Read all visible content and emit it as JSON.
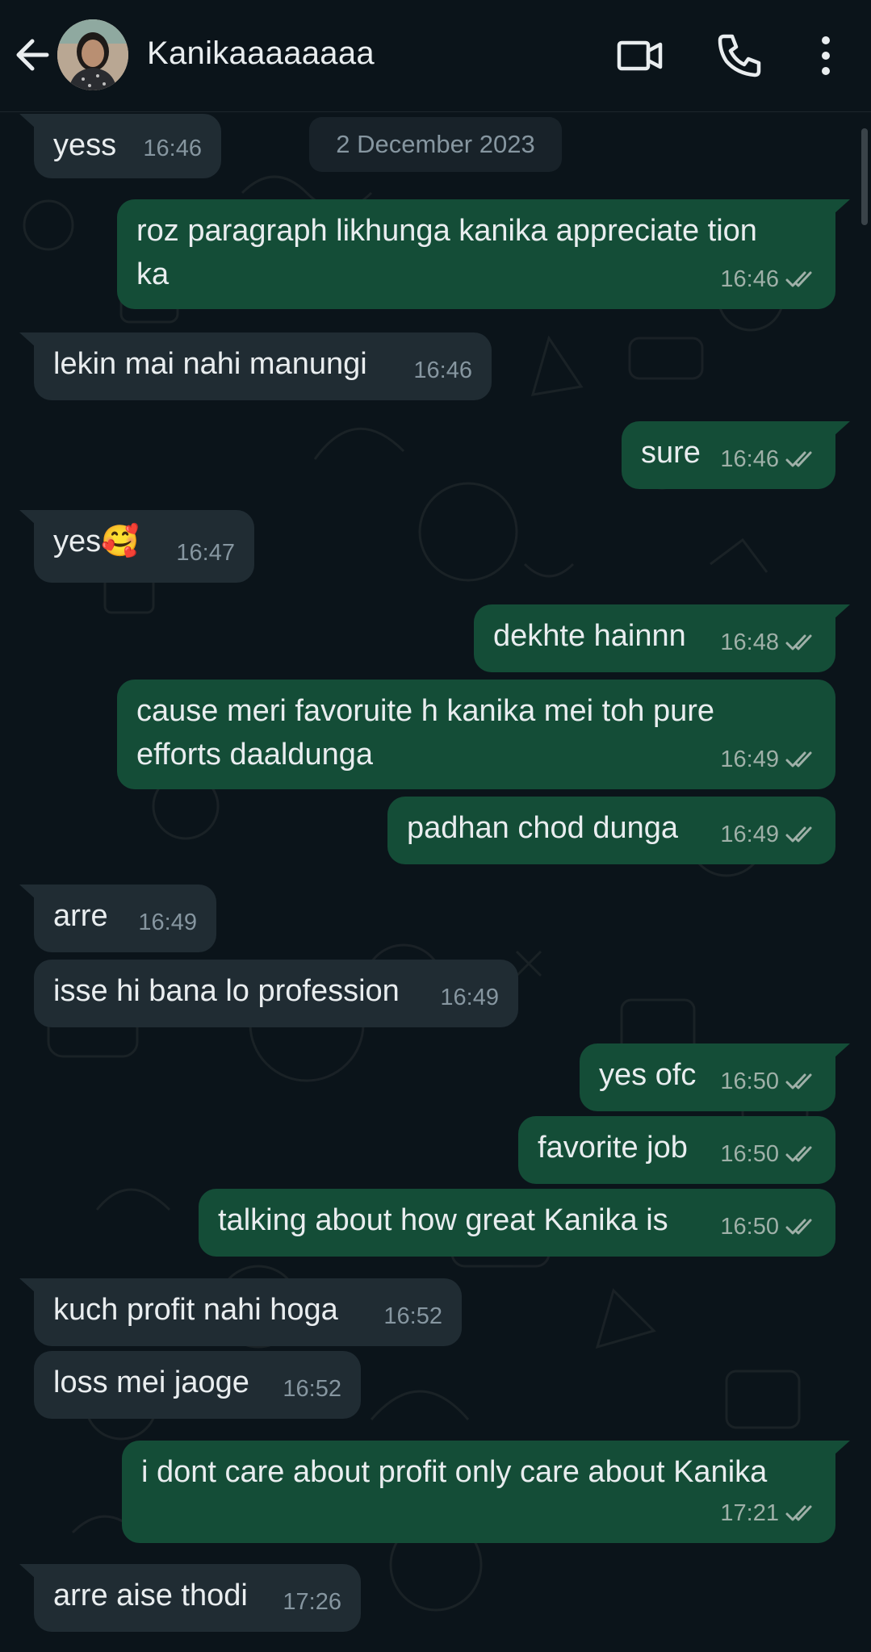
{
  "header": {
    "contact_name": "Kanikaaaaaaaa",
    "icons": [
      "back-arrow-icon",
      "video-call-icon",
      "voice-call-icon",
      "more-options-icon"
    ]
  },
  "date_chip": "2 December 2023",
  "messages": [
    {
      "dir": "in",
      "text": "yess",
      "time": "16:46"
    },
    {
      "dir": "out",
      "text": "roz paragraph likhunga kanika appreciate tion",
      "text2": "ka",
      "time": "16:46",
      "read": true
    },
    {
      "dir": "in",
      "text": "lekin mai nahi manungi",
      "time": "16:46"
    },
    {
      "dir": "out",
      "text": "sure",
      "time": "16:46",
      "read": true
    },
    {
      "dir": "in",
      "text": "yes🥰",
      "time": "16:47"
    },
    {
      "dir": "out",
      "text": "dekhte hainnn",
      "time": "16:48",
      "read": true
    },
    {
      "dir": "out",
      "text": "cause meri favoruite h kanika mei toh pure",
      "text2": "efforts daaldunga",
      "time": "16:49",
      "read": true
    },
    {
      "dir": "out",
      "text": "padhan chod dunga",
      "time": "16:49",
      "read": true
    },
    {
      "dir": "in",
      "text": "arre",
      "time": "16:49"
    },
    {
      "dir": "in",
      "text": "isse hi bana lo profession",
      "time": "16:49"
    },
    {
      "dir": "out",
      "text": "yes ofc",
      "time": "16:50",
      "read": true
    },
    {
      "dir": "out",
      "text": "favorite job",
      "time": "16:50",
      "read": true
    },
    {
      "dir": "out",
      "text": "talking about how great Kanika is",
      "time": "16:50",
      "read": true
    },
    {
      "dir": "in",
      "text": "kuch profit nahi hoga",
      "time": "16:52"
    },
    {
      "dir": "in",
      "text": "loss mei jaoge",
      "time": "16:52"
    },
    {
      "dir": "out",
      "text": "i dont care about profit only care about Kanika",
      "time": "17:21",
      "read": true
    },
    {
      "dir": "in",
      "text": "arre aise thodi",
      "time": "17:26"
    }
  ],
  "colors": {
    "background": "#0b141a",
    "incoming_bubble": "#202c33",
    "outgoing_bubble": "#144d37",
    "meta_text": "#8696a0"
  }
}
